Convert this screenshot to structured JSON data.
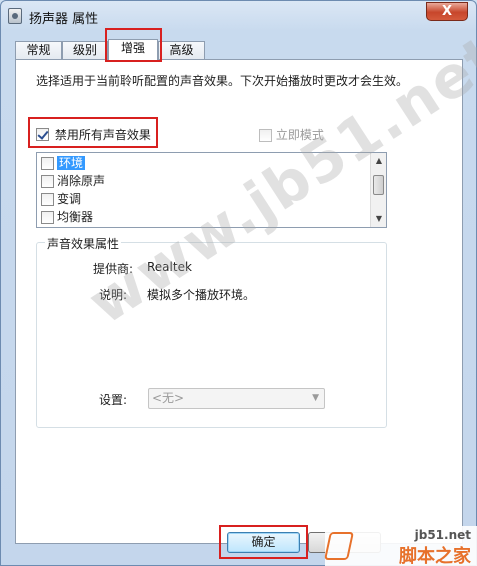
{
  "window": {
    "title": "扬声器 属性",
    "close_glyph": "X"
  },
  "tabs": [
    {
      "label": "常规"
    },
    {
      "label": "级别"
    },
    {
      "label": "增强"
    },
    {
      "label": "高级"
    }
  ],
  "panel": {
    "description": "选择适用于当前聆听配置的声音效果。下次开始播放时更改才会生效。",
    "disable_all": {
      "label": "禁用所有声音效果",
      "checked": true
    },
    "immediate_mode": {
      "label": "立即模式",
      "checked": false,
      "enabled": false
    },
    "effects": [
      {
        "label": "环境",
        "checked": false,
        "selected": true
      },
      {
        "label": "消除原声",
        "checked": false
      },
      {
        "label": "变调",
        "checked": false
      },
      {
        "label": "均衡器",
        "checked": false
      }
    ],
    "properties": {
      "title": "声音效果属性",
      "provider_label": "提供商:",
      "provider_value": "Realtek",
      "description_label": "说明:",
      "description_value": "模拟多个播放环境。",
      "settings_label": "设置:",
      "settings_value": "<无>"
    }
  },
  "buttons": {
    "ok": "确定"
  },
  "watermark": {
    "text": "www.jb51.net",
    "logo_url": "jb51.net",
    "logo_name": "脚本之家"
  },
  "colors": {
    "highlight": "#d8201f",
    "selection": "#3399ff",
    "ok_border": "#3c7fb1"
  }
}
